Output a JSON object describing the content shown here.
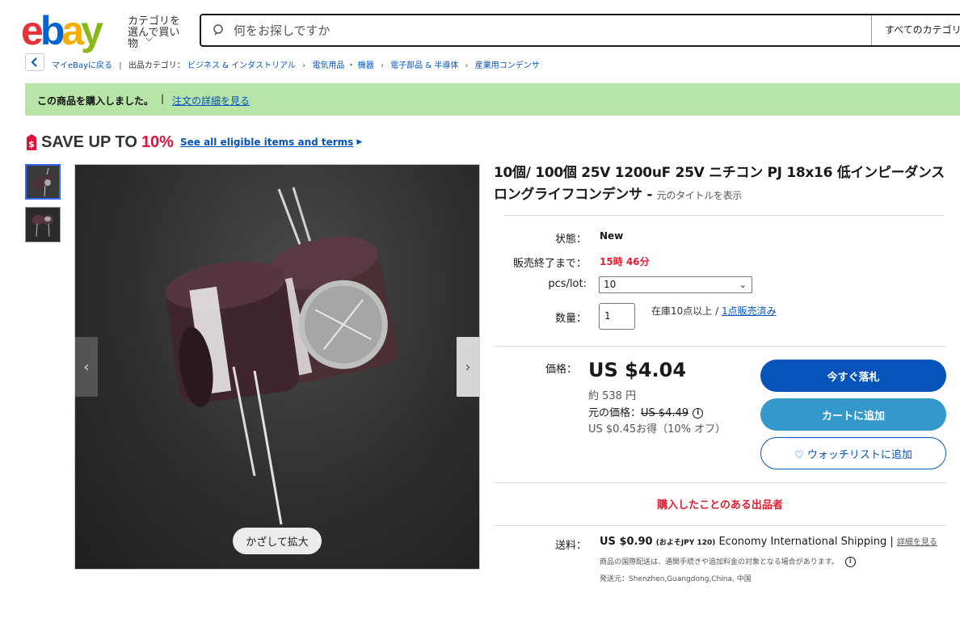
{
  "header": {
    "logo_letters": [
      {
        "char": "e",
        "color": "#e53238"
      },
      {
        "char": "b",
        "color": "#0064d2"
      },
      {
        "char": "a",
        "color": "#f5af02"
      },
      {
        "char": "y",
        "color": "#86b817"
      }
    ],
    "category_button": "カテゴリを選んで買い物",
    "search_placeholder": "何をお探しですか",
    "category_select": "すべてのカテゴリ"
  },
  "breadcrumb": {
    "back": "マイeBayに戻る",
    "category_label": "出品カテゴリ：",
    "items": [
      "ビジネス & インダストリアル",
      "電気用品 ・ 機器",
      "電子部品 & 半導体",
      "産業用コンデンサ"
    ]
  },
  "banner": {
    "message": "この商品を購入しました。",
    "separator": "|",
    "link": "注文の詳細を見る"
  },
  "promo": {
    "text": "SAVE UP TO",
    "percent": "10%",
    "link": "See all eligible items and terms"
  },
  "gallery": {
    "zoom_label": "かざして拡大"
  },
  "item": {
    "title": "10個/ 100個 25V 1200uF 25V ニチコン PJ 18x16 低インピーダンスロングライフコンデンサ",
    "title_separator": " - ",
    "original_title_link": "元のタイトルを表示",
    "condition_label": "状態：",
    "condition": "New",
    "time_left_label": "販売終了まで：",
    "time_left": "15時 46分",
    "variation_label": "pcs/lot:",
    "variation_value": "10",
    "quantity_label": "数量：",
    "quantity": "1",
    "stock_text": "在庫10点以上 / ",
    "sold_link": "1点販売済み",
    "price_label": "価格：",
    "price": "US $4.04",
    "approx_price": "約 538 円",
    "original_price_label": "元の価格：",
    "original_price": "US $4.49",
    "savings": "US $0.45お得（10% オフ）",
    "buy_now": "今すぐ落札",
    "add_to_cart": "カートに追加",
    "watchlist": "♡ ウォッチリストに追加",
    "seller_note": "購入したことのある出品者",
    "shipping_label": "送料：",
    "shipping_price": "US $0.90",
    "shipping_jpy": "(およそJPY 120)",
    "shipping_method": "Economy International Shipping",
    "shipping_separator": " | ",
    "shipping_details": "詳細を見る",
    "shipping_note": "商品の国際配送は、通関手続きや追加料金の対象となる場合があります。",
    "ships_from": "発送元：Shenzhen,Guangdong,China, 中国"
  },
  "colors": {
    "accent": "#0654ba",
    "cart": "#3498ca",
    "banner": "#b8e4a7",
    "alert": "#dd1e31"
  }
}
